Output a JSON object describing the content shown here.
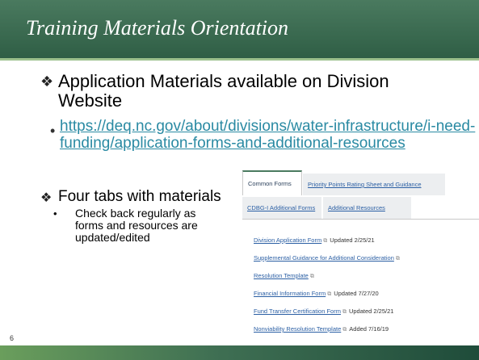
{
  "slide": {
    "title": "Training Materials Orientation",
    "page_number": "6",
    "bullets": [
      {
        "marker": "❖",
        "text": "Application Materials available on Division Website"
      },
      {
        "marker": "❖",
        "text": "Four tabs with materials"
      }
    ],
    "sub_bullets": [
      {
        "marker": "•",
        "text": "https://deq.nc.gov/about/divisions/water-infrastructure/i-need-funding/application-forms-and-additional-resources"
      },
      {
        "marker": "•",
        "text": "Check back regularly as forms and resources are updated/edited"
      }
    ]
  },
  "webpage": {
    "tabs": [
      {
        "label": "Common Forms",
        "active": true
      },
      {
        "label": "Priority Points Rating Sheet and Guidance",
        "active": false
      },
      {
        "label": "CDBG-I Additional Forms",
        "active": false
      },
      {
        "label": "Additional Resources",
        "active": false
      }
    ],
    "items": [
      {
        "label": "Division Application Form",
        "icon": "external-link-icon",
        "ext_glyph": "⧉",
        "note": "Updated 2/25/21"
      },
      {
        "label": "Supplemental Guidance for Additional Consideration",
        "icon": "external-link-icon",
        "ext_glyph": "⧉",
        "note": ""
      },
      {
        "label": "Resolution Template",
        "icon": "external-link-icon",
        "ext_glyph": "⧉",
        "note": ""
      },
      {
        "label": "Financial Information Form",
        "icon": "external-link-icon",
        "ext_glyph": "⧉",
        "note": "Updated 7/27/20"
      },
      {
        "label": "Fund Transfer Certification Form",
        "icon": "external-link-icon",
        "ext_glyph": "⧉",
        "note": "Updated 2/25/21"
      },
      {
        "label": "Nonviability Resolution Template",
        "icon": "external-link-icon",
        "ext_glyph": "⧉",
        "note": "Added 7/16/19"
      }
    ]
  },
  "colors": {
    "title_bar": "#2f5e45",
    "title_rule": "#9cc18c",
    "link": "#2a8aa3",
    "web_link": "#2b5fa4"
  }
}
